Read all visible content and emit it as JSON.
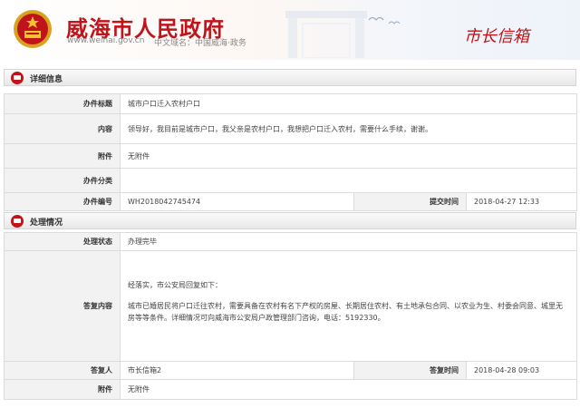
{
  "header": {
    "site_title": "威海市人民政府",
    "site_url": "www.weihai.gov.cn",
    "site_domain_cn": "中文域名：中国威海·政务",
    "section_label": "市长信箱"
  },
  "detail": {
    "section_title": "详细信息",
    "rows": {
      "title_label": "办件标题",
      "title_value": "城市户口迁入农村户口",
      "content_label": "内容",
      "content_value": "领导好，我目前是城市户口，我父亲是农村户口，我想把户口迁入农村，需要什么手续，谢谢。",
      "attachment_label": "附件",
      "attachment_value": "无附件",
      "category_label": "办件分类",
      "category_value": "",
      "number_label": "办件编号",
      "number_value": "WH2018042745474",
      "submit_time_label": "提交时间",
      "submit_time_value": "2018-04-27 12:33"
    }
  },
  "handling": {
    "section_title": "处理情况",
    "rows": {
      "status_label": "处理状态",
      "status_value": "办理完毕",
      "reply_label": "答复内容",
      "reply_para1": "经落实，市公安局回复如下：",
      "reply_para2": "城市已婚居民将户口迁往农村，需要具备在农村有名下产权的房屋、长期居住农村、有土地承包合同、以农业为生、村委会同意、城里无房等等条件。详细情况可向威海市公安局户政管理部门咨询，电话：5192330。",
      "replier_label": "答复人",
      "replier_value": "市长信箱2",
      "reply_time_label": "答复时间",
      "reply_time_value": "2018-04-28 09:03",
      "attachment_label": "附件",
      "attachment_value": "无附件"
    }
  },
  "colors": {
    "brand_red": "#c0141b",
    "label_bg": "#f2f2f2",
    "border": "#dcdcdc"
  },
  "icons": {
    "emblem": "national-emblem-icon",
    "section": "mail-icon"
  }
}
